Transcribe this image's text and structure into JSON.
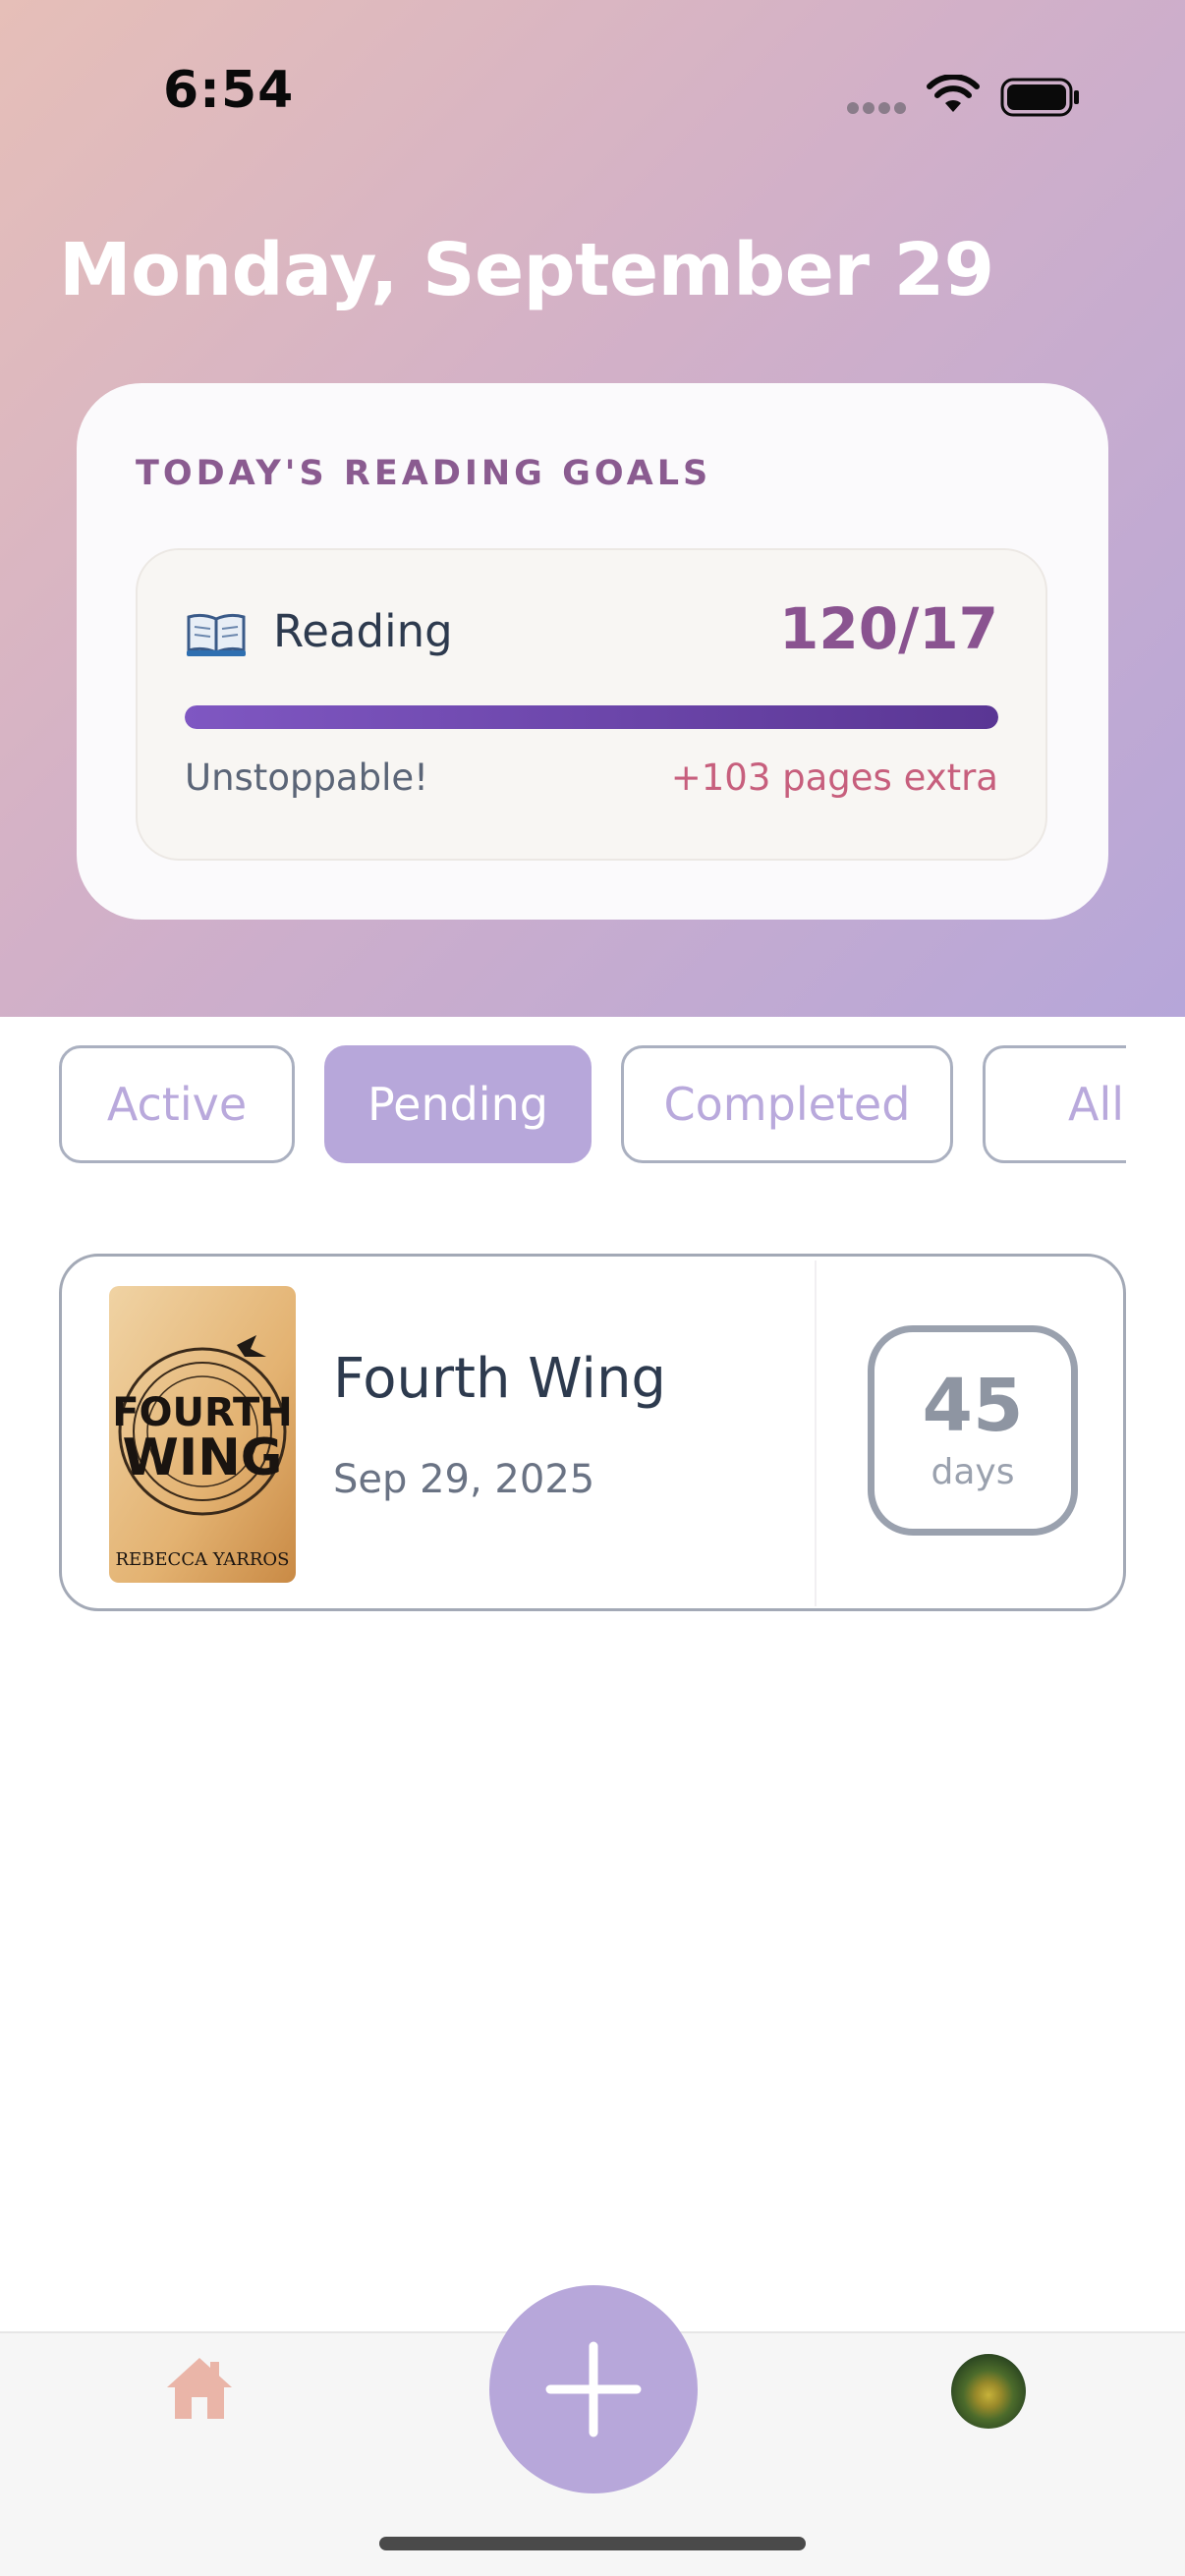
{
  "status_bar": {
    "time": "6:54",
    "icons": [
      "signal-icon",
      "wifi-icon",
      "battery-icon"
    ]
  },
  "header": {
    "date_title": "Monday, September 29"
  },
  "goals_card": {
    "heading": "TODAY'S READING GOALS",
    "goal": {
      "icon": "open-book-icon",
      "label": "Reading",
      "count": "120/17",
      "progress_fraction": 1.0,
      "status": "Unstoppable!",
      "extra": "+103 pages extra"
    }
  },
  "filters": {
    "tabs": [
      {
        "label": "Active",
        "selected": false
      },
      {
        "label": "Pending",
        "selected": true
      },
      {
        "label": "Completed",
        "selected": false
      },
      {
        "label": "All",
        "selected": false
      }
    ]
  },
  "books": [
    {
      "title": "Fourth Wing",
      "date": "Sep 29, 2025",
      "days_value": "45",
      "days_unit": "days",
      "cover": {
        "title_line1": "FOURTH",
        "title_line2": "WING",
        "author": "REBECCA YARROS"
      }
    }
  ],
  "tab_bar": {
    "home_icon": "home-icon",
    "add_icon": "plus-icon",
    "avatar": "profile-avatar"
  },
  "colors": {
    "accent": "#b7a7da",
    "goal_heading": "#8a5b90",
    "extra_text": "#c75f7d",
    "progress_fill": "#6a45a8"
  }
}
